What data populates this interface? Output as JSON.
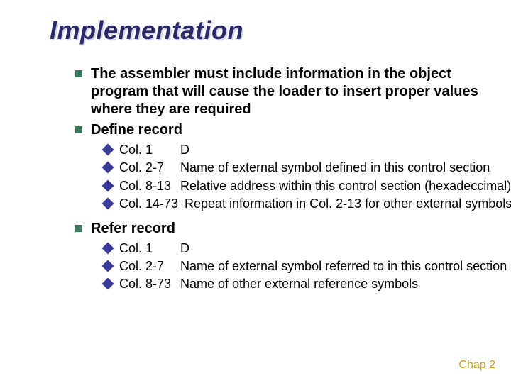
{
  "title": "Implementation",
  "bullets": {
    "b1": "The assembler must include information in the object program that will cause the loader to insert proper values where they are required",
    "b2": "Define record",
    "b3": "Refer record"
  },
  "define": {
    "r1_col": "Col. 1",
    "r1_txt": "D",
    "r2_col": "Col. 2-7",
    "r2_txt": "Name of external symbol defined in this control section",
    "r3_col": "Col. 8-13",
    "r3_txt": "Relative address within this control section (hexadeccimal)",
    "r4_col": "Col. 14-73",
    "r4_txt": "Repeat information in Col. 2-13 for other external symbols"
  },
  "refer": {
    "r1_col": "Col. 1",
    "r1_txt": "D",
    "r2_col": "Col. 2-7",
    "r2_txt": "Name of external symbol referred to in this control section",
    "r3_col": "Col. 8-73",
    "r3_txt": "Name of other external reference symbols"
  },
  "footer": "Chap 2"
}
